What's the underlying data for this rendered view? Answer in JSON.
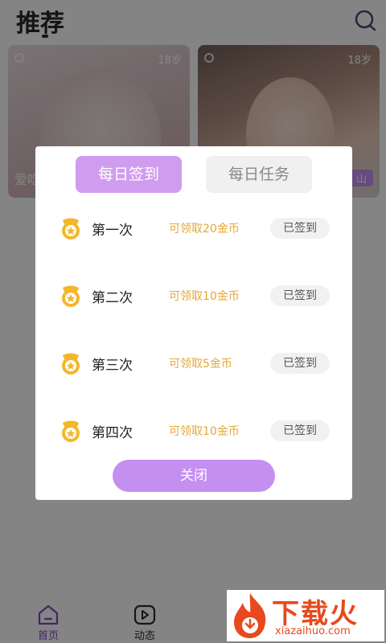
{
  "header": {
    "title": "推荐"
  },
  "cards": [
    {
      "age": "18岁",
      "name": "爱吃",
      "tag": ""
    },
    {
      "age": "18岁",
      "name": "",
      "tag": "山"
    }
  ],
  "tabbar": {
    "home": "首页",
    "dynamic": "动态"
  },
  "watermark": {
    "main": "下载火",
    "sub": "xiazaihuo.com"
  },
  "modal": {
    "tabs": {
      "checkin": "每日签到",
      "task": "每日任务"
    },
    "rows": [
      {
        "label": "第一次",
        "reward": "可领取20金币",
        "status": "已签到"
      },
      {
        "label": "第二次",
        "reward": "可领取10金币",
        "status": "已签到"
      },
      {
        "label": "第三次",
        "reward": "可领取5金币",
        "status": "已签到"
      },
      {
        "label": "第四次",
        "reward": "可领取10金币",
        "status": "已签到"
      }
    ],
    "close_label": "关闭"
  },
  "colors": {
    "accent": "#c58ff0",
    "reward": "#e3a83a",
    "coin": "#f5b62b"
  },
  "icons": {
    "search": "search-icon",
    "coin": "coin-icon",
    "home": "home-icon",
    "dynamic": "play-icon"
  }
}
